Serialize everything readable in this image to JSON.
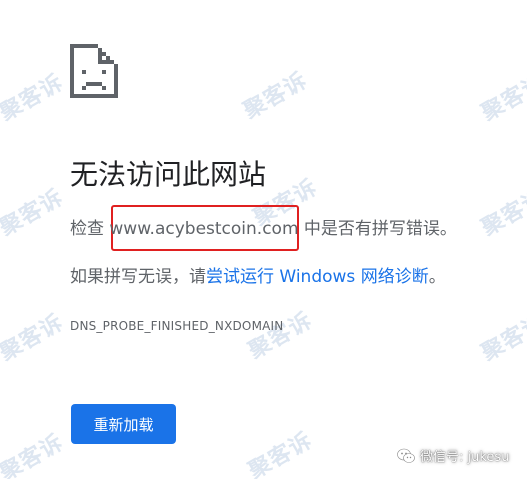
{
  "error": {
    "title": "无法访问此网站",
    "check_prefix": "检查 ",
    "domain": "www.acybestcoin.com",
    "check_suffix": " 中是否有拼写错误。",
    "suggestion_prefix": "如果拼写无误，请",
    "diagnostics_link": "尝试运行 Windows 网络诊断",
    "suggestion_suffix": "。",
    "code": "DNS_PROBE_FINISHED_NXDOMAIN",
    "reload_label": "重新加载"
  },
  "watermark": {
    "text": "聚客诉",
    "source_label": "微信号: jukesu"
  },
  "icons": {
    "page_icon": "sad-page-icon",
    "wechat_icon": "wechat-icon"
  },
  "colors": {
    "link": "#1a73e8",
    "button": "#1a73e8",
    "highlight": "#e02020",
    "text": "#202124",
    "secondary_text": "#5f6368"
  }
}
